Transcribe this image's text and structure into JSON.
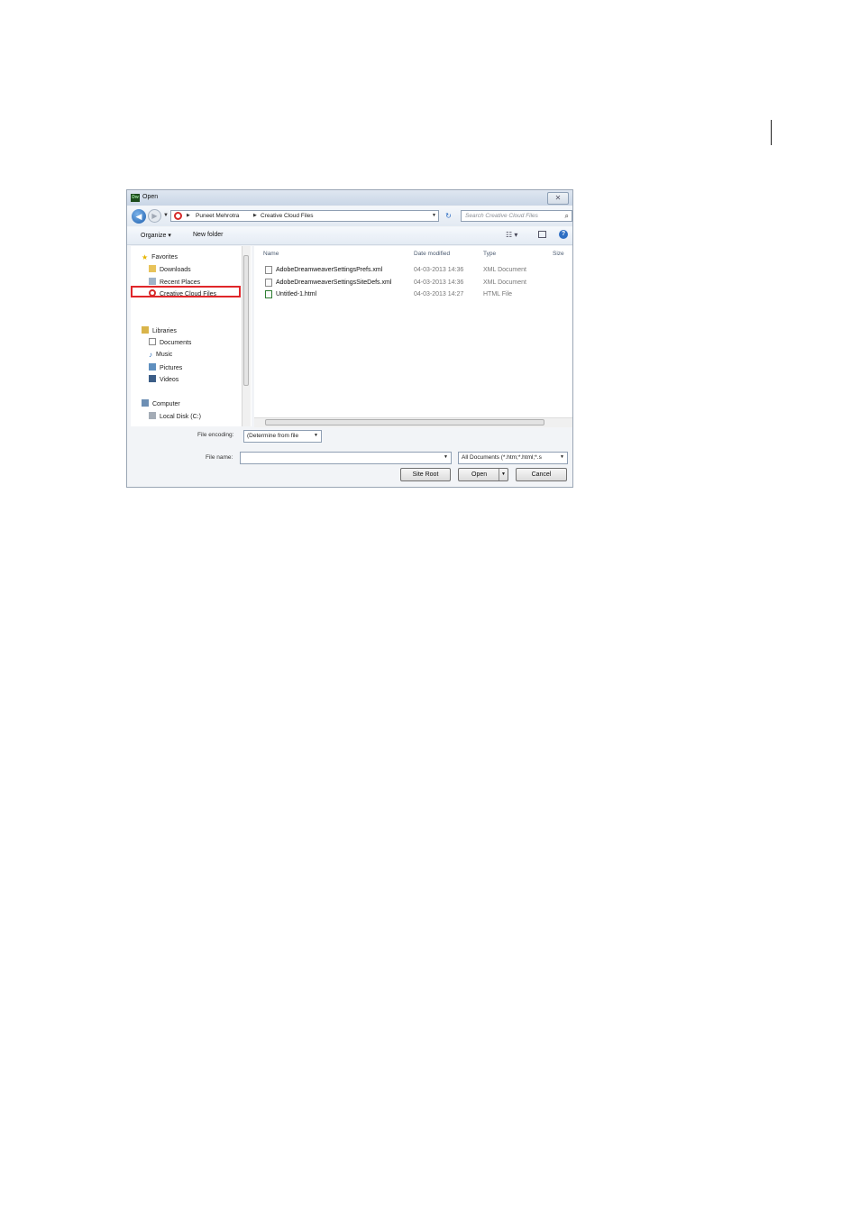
{
  "dialog": {
    "title": "Open",
    "app_badge": "Dw",
    "close_glyph": "✕"
  },
  "nav": {
    "back_glyph": "◀",
    "forward_glyph": "▶",
    "breadcrumbs": [
      "Puneet Mehrotra",
      "Creative Cloud Files"
    ],
    "search_placeholder": "Search Creative Cloud Files"
  },
  "toolbar": {
    "organize": "Organize ▾",
    "new_folder": "New folder"
  },
  "sidebar": {
    "favorites": {
      "label": "Favorites",
      "items": [
        "Downloads",
        "Recent Places",
        "Creative Cloud Files"
      ]
    },
    "libraries": {
      "label": "Libraries",
      "items": [
        "Documents",
        "Music",
        "Pictures",
        "Videos"
      ]
    },
    "computer": {
      "label": "Computer",
      "items": [
        "Local Disk (C:)"
      ]
    },
    "selected": "Creative Cloud Files"
  },
  "columns": [
    "Name",
    "Date modified",
    "Type",
    "Size"
  ],
  "files": [
    {
      "name": "AdobeDreamweaverSettingsPrefs.xml",
      "date": "04-03-2013 14:36",
      "type": "XML Document"
    },
    {
      "name": "AdobeDreamweaverSettingsSiteDefs.xml",
      "date": "04-03-2013 14:36",
      "type": "XML Document"
    },
    {
      "name": "Untitled-1.html",
      "date": "04-03-2013 14:27",
      "type": "HTML File"
    }
  ],
  "footer": {
    "encoding_label": "File encoding:",
    "encoding_value": "(Determine from file",
    "filename_label": "File name:",
    "filename_value": "",
    "filter_value": "All Documents (*.htm;*.html;*.s",
    "site_root": "Site Root",
    "open": "Open",
    "cancel": "Cancel"
  },
  "colors": {
    "selection_outline": "#e0262a",
    "creative_cloud": "#d62b2b",
    "back_button": "#1f5fae"
  }
}
